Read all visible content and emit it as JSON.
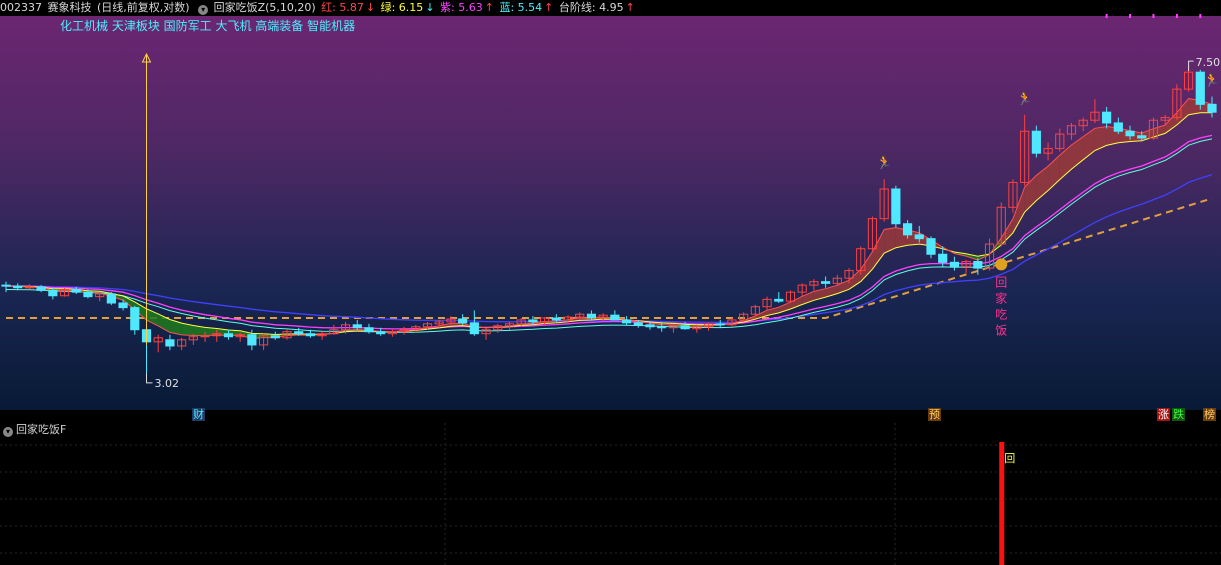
{
  "header": {
    "code": "002337",
    "name": "赛象科技",
    "period": "(日线,前复权,对数)",
    "indicator": "回家吃饭Z(5,10,20)",
    "red_label": "红: 5.87",
    "green_label": "绿: 6.15",
    "purple_label": "紫: 5.63",
    "blue_label": "蓝: 5.54",
    "step_label": "台阶线: 4.95"
  },
  "concepts": "化工机械 天津板块 国防军工 大飞机 高端装备 智能机器",
  "annotations": {
    "high": "7.50",
    "low": "3.02",
    "signal_vertical": "回家吃饭",
    "sub_mark": "回"
  },
  "events": [
    {
      "label": "财",
      "color": "#4af0ff",
      "bg": "#223a66"
    },
    {
      "label": "预",
      "color": "#ffd060",
      "bg": "#6a3a10"
    },
    {
      "label": "涨",
      "color": "#ffffff",
      "bg": "#aa1010"
    },
    {
      "label": "跌",
      "color": "#40ff40",
      "bg": "#115511"
    },
    {
      "label": "榜",
      "color": "#ffd060",
      "bg": "#6a3a10"
    }
  ],
  "sub_panel": {
    "title": "回家吃饭F"
  },
  "chart_data": {
    "type": "candlestick",
    "ohlc": [
      [
        3.98,
        4.02,
        3.9,
        3.97
      ],
      [
        3.97,
        4.0,
        3.92,
        3.95
      ],
      [
        3.95,
        3.99,
        3.93,
        3.96
      ],
      [
        3.96,
        3.98,
        3.9,
        3.92
      ],
      [
        3.92,
        3.95,
        3.82,
        3.86
      ],
      [
        3.86,
        3.95,
        3.85,
        3.93
      ],
      [
        3.93,
        3.96,
        3.88,
        3.9
      ],
      [
        3.9,
        3.93,
        3.83,
        3.85
      ],
      [
        3.85,
        3.9,
        3.8,
        3.88
      ],
      [
        3.88,
        3.9,
        3.76,
        3.78
      ],
      [
        3.78,
        3.82,
        3.7,
        3.73
      ],
      [
        3.73,
        3.75,
        3.45,
        3.5
      ],
      [
        3.5,
        3.55,
        3.02,
        3.38
      ],
      [
        3.38,
        3.45,
        3.28,
        3.42
      ],
      [
        3.4,
        3.45,
        3.3,
        3.34
      ],
      [
        3.34,
        3.42,
        3.3,
        3.4
      ],
      [
        3.4,
        3.46,
        3.35,
        3.43
      ],
      [
        3.43,
        3.48,
        3.38,
        3.44
      ],
      [
        3.44,
        3.5,
        3.38,
        3.46
      ],
      [
        3.46,
        3.5,
        3.4,
        3.43
      ],
      [
        3.43,
        3.47,
        3.38,
        3.45
      ],
      [
        3.45,
        3.5,
        3.3,
        3.35
      ],
      [
        3.35,
        3.46,
        3.3,
        3.44
      ],
      [
        3.44,
        3.48,
        3.4,
        3.42
      ],
      [
        3.42,
        3.5,
        3.4,
        3.48
      ],
      [
        3.48,
        3.52,
        3.44,
        3.46
      ],
      [
        3.46,
        3.5,
        3.42,
        3.44
      ],
      [
        3.44,
        3.48,
        3.4,
        3.46
      ],
      [
        3.46,
        3.55,
        3.45,
        3.5
      ],
      [
        3.5,
        3.58,
        3.46,
        3.55
      ],
      [
        3.55,
        3.6,
        3.5,
        3.52
      ],
      [
        3.52,
        3.56,
        3.46,
        3.48
      ],
      [
        3.48,
        3.52,
        3.44,
        3.46
      ],
      [
        3.46,
        3.5,
        3.43,
        3.48
      ],
      [
        3.48,
        3.53,
        3.45,
        3.5
      ],
      [
        3.5,
        3.55,
        3.47,
        3.53
      ],
      [
        3.53,
        3.58,
        3.5,
        3.56
      ],
      [
        3.56,
        3.6,
        3.52,
        3.58
      ],
      [
        3.58,
        3.64,
        3.55,
        3.61
      ],
      [
        3.61,
        3.66,
        3.55,
        3.57
      ],
      [
        3.57,
        3.7,
        3.44,
        3.46
      ],
      [
        3.46,
        3.52,
        3.4,
        3.5
      ],
      [
        3.5,
        3.56,
        3.47,
        3.54
      ],
      [
        3.54,
        3.58,
        3.5,
        3.56
      ],
      [
        3.56,
        3.62,
        3.53,
        3.6
      ],
      [
        3.6,
        3.64,
        3.55,
        3.58
      ],
      [
        3.58,
        3.63,
        3.55,
        3.62
      ],
      [
        3.62,
        3.66,
        3.58,
        3.6
      ],
      [
        3.6,
        3.65,
        3.56,
        3.63
      ],
      [
        3.63,
        3.68,
        3.6,
        3.66
      ],
      [
        3.66,
        3.7,
        3.6,
        3.62
      ],
      [
        3.62,
        3.67,
        3.58,
        3.65
      ],
      [
        3.65,
        3.7,
        3.6,
        3.6
      ],
      [
        3.6,
        3.64,
        3.54,
        3.57
      ],
      [
        3.57,
        3.6,
        3.52,
        3.55
      ],
      [
        3.55,
        3.59,
        3.5,
        3.53
      ],
      [
        3.53,
        3.58,
        3.48,
        3.52
      ],
      [
        3.52,
        3.56,
        3.47,
        3.54
      ],
      [
        3.54,
        3.58,
        3.5,
        3.51
      ],
      [
        3.51,
        3.55,
        3.47,
        3.53
      ],
      [
        3.53,
        3.57,
        3.49,
        3.56
      ],
      [
        3.56,
        3.6,
        3.52,
        3.55
      ],
      [
        3.55,
        3.62,
        3.53,
        3.6
      ],
      [
        3.6,
        3.68,
        3.58,
        3.66
      ],
      [
        3.66,
        3.76,
        3.64,
        3.74
      ],
      [
        3.74,
        3.85,
        3.7,
        3.82
      ],
      [
        3.82,
        3.9,
        3.78,
        3.8
      ],
      [
        3.8,
        3.92,
        3.78,
        3.9
      ],
      [
        3.9,
        4.0,
        3.86,
        3.98
      ],
      [
        3.98,
        4.05,
        3.92,
        4.02
      ],
      [
        4.02,
        4.08,
        3.95,
        4.0
      ],
      [
        4.0,
        4.1,
        3.97,
        4.06
      ],
      [
        4.06,
        4.18,
        4.0,
        4.15
      ],
      [
        4.15,
        4.45,
        4.1,
        4.42
      ],
      [
        4.42,
        4.85,
        4.4,
        4.82
      ],
      [
        4.82,
        5.4,
        4.78,
        5.25
      ],
      [
        5.25,
        5.3,
        4.7,
        4.75
      ],
      [
        4.75,
        4.8,
        4.55,
        4.6
      ],
      [
        4.6,
        4.72,
        4.5,
        4.55
      ],
      [
        4.55,
        4.58,
        4.3,
        4.35
      ],
      [
        4.35,
        4.45,
        4.2,
        4.25
      ],
      [
        4.25,
        4.32,
        4.15,
        4.2
      ],
      [
        4.2,
        4.28,
        4.12,
        4.26
      ],
      [
        4.26,
        4.3,
        4.1,
        4.18
      ],
      [
        4.18,
        4.55,
        4.15,
        4.48
      ],
      [
        4.48,
        5.05,
        4.45,
        4.98
      ],
      [
        4.98,
        5.4,
        4.9,
        5.35
      ],
      [
        5.35,
        6.5,
        5.3,
        6.2
      ],
      [
        6.2,
        6.3,
        5.75,
        5.82
      ],
      [
        5.82,
        6.0,
        5.7,
        5.9
      ],
      [
        5.9,
        6.25,
        5.85,
        6.15
      ],
      [
        6.15,
        6.35,
        6.05,
        6.3
      ],
      [
        6.3,
        6.45,
        6.2,
        6.4
      ],
      [
        6.4,
        6.8,
        6.35,
        6.55
      ],
      [
        6.55,
        6.65,
        6.25,
        6.35
      ],
      [
        6.35,
        6.45,
        6.15,
        6.2
      ],
      [
        6.2,
        6.3,
        6.05,
        6.12
      ],
      [
        6.12,
        6.2,
        6.02,
        6.08
      ],
      [
        6.08,
        6.45,
        6.05,
        6.4
      ],
      [
        6.4,
        6.5,
        6.3,
        6.45
      ],
      [
        6.45,
        7.1,
        6.4,
        7.0
      ],
      [
        7.0,
        7.5,
        6.95,
        7.35
      ],
      [
        7.35,
        7.4,
        6.6,
        6.7
      ],
      [
        6.7,
        6.85,
        6.45,
        6.55
      ]
    ],
    "series": [
      {
        "name": "红",
        "value": 5.87
      },
      {
        "name": "绿",
        "value": 6.15
      },
      {
        "name": "紫",
        "value": 5.63
      },
      {
        "name": "蓝",
        "value": 5.54
      },
      {
        "name": "台阶线",
        "value": 4.95
      }
    ],
    "scale": "log",
    "ylim": [
      2.9,
      8.3
    ],
    "high_marker": 7.5,
    "low_marker": 3.02,
    "signal_index": 85,
    "grid": false,
    "colors": {
      "up": "#ff4040",
      "down": "#50e8ff",
      "step": "#e0a040",
      "fast": "#ffff40",
      "slow": "#ff40ff",
      "blue": "#4040ff"
    }
  }
}
